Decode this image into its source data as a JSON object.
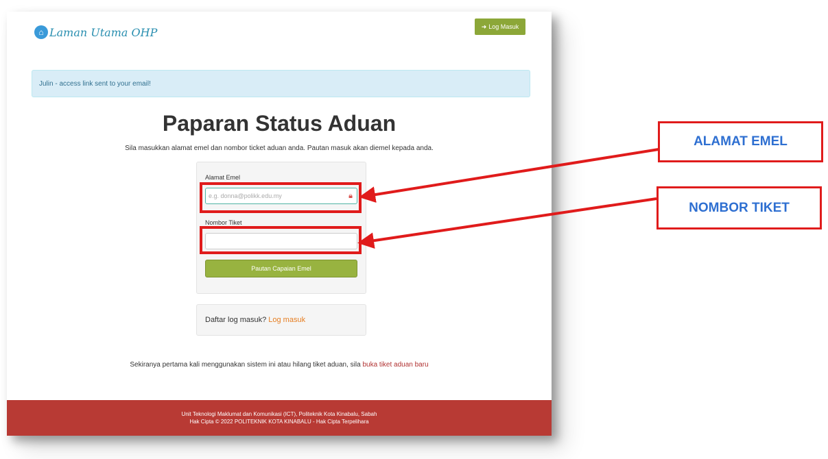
{
  "header": {
    "logo_text": "Laman Utama OHP",
    "login_button": "Log Masuk"
  },
  "alert": {
    "text": "Julin - access link sent to your email!"
  },
  "main": {
    "title": "Paparan Status Aduan",
    "subtitle": "Sila masukkan alamat emel dan nombor ticket aduan anda. Pautan masuk akan diemel kepada anda."
  },
  "form": {
    "email_label": "Alamat Emel",
    "email_placeholder": "e.g. donna@polikk.edu.my",
    "ticket_label": "Nombor Tiket",
    "ticket_value": "",
    "submit_label": "Pautan Capaian Emel"
  },
  "login_panel": {
    "prompt": "Daftar log masuk?",
    "link": "Log masuk"
  },
  "note": {
    "text": "Sekiranya pertama kali menggunakan sistem ini atau hilang tiket aduan, sila",
    "link": "buka tiket aduan baru"
  },
  "footer": {
    "line1": "Unit Teknologi Maklumat dan Komunikasi (ICT), Politeknik Kota Kinabalu, Sabah",
    "line2": "Hak Cipta © 2022 POLITEKNIK KOTA KINABALU - Hak Cipta Terpelihara"
  },
  "annotations": {
    "email_callout": "ALAMAT EMEL",
    "ticket_callout": "NOMBOR TIKET",
    "color": "#e01b1b",
    "text_color": "#2e6fd1"
  }
}
